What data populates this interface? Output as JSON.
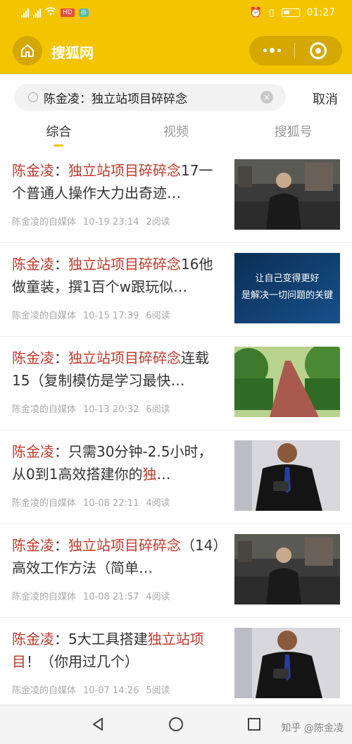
{
  "status_bar": {
    "carrier_badge": "HD",
    "time": "01:27"
  },
  "header": {
    "title": "搜狐网"
  },
  "search": {
    "query": "陈金凌：独立站项目碎碎念",
    "cancel_label": "取消"
  },
  "tabs": [
    {
      "label": "综合",
      "active": true
    },
    {
      "label": "视频",
      "active": false
    },
    {
      "label": "搜狐号",
      "active": false
    }
  ],
  "results": [
    {
      "title_parts": [
        {
          "text": "陈金凌",
          "hl": true
        },
        {
          "text": "：",
          "hl": false
        },
        {
          "text": "独立站项目碎碎念",
          "hl": true
        },
        {
          "text": "17一个普通人操作大力出奇迹…",
          "hl": false
        }
      ],
      "source": "陈金凌的自媒体",
      "date": "10-19 23:14",
      "reads": "2阅读",
      "thumb": "man-street"
    },
    {
      "title_parts": [
        {
          "text": "陈金凌",
          "hl": true
        },
        {
          "text": "：",
          "hl": false
        },
        {
          "text": "独立站项目碎碎念",
          "hl": true
        },
        {
          "text": "16他做童装，撰1百个w跟玩似…",
          "hl": false
        }
      ],
      "source": "陈金凌的自媒体",
      "date": "10-15 17:39",
      "reads": "6阅读",
      "thumb": "text-banner",
      "thumb_line1": "让自己变得更好",
      "thumb_line2": "是解决一切问题的关键"
    },
    {
      "title_parts": [
        {
          "text": "陈金凌",
          "hl": true
        },
        {
          "text": "：",
          "hl": false
        },
        {
          "text": "独立站项目碎碎念",
          "hl": true
        },
        {
          "text": "连载15（复制模仿是学习最快…",
          "hl": false
        }
      ],
      "source": "陈金凌的自媒体",
      "date": "10-13 20:32",
      "reads": "6阅读",
      "thumb": "garden-path"
    },
    {
      "title_parts": [
        {
          "text": "陈金凌",
          "hl": true
        },
        {
          "text": "：只需30分钟-2.5小时，从0到1高效搭建你的",
          "hl": false
        },
        {
          "text": "独",
          "hl": true
        },
        {
          "text": "…",
          "hl": false
        }
      ],
      "source": "陈金凌的自媒体",
      "date": "10-08 22:11",
      "reads": "4阅读",
      "thumb": "man-phone"
    },
    {
      "title_parts": [
        {
          "text": "陈金凌",
          "hl": true
        },
        {
          "text": "：",
          "hl": false
        },
        {
          "text": "独立站项目碎碎念",
          "hl": true
        },
        {
          "text": "（14）高效工作方法（简单…",
          "hl": false
        }
      ],
      "source": "陈金凌的自媒体",
      "date": "10-08 21:57",
      "reads": "4阅读",
      "thumb": "man-street"
    },
    {
      "title_parts": [
        {
          "text": "陈金凌",
          "hl": true
        },
        {
          "text": "：5大工具搭建",
          "hl": false
        },
        {
          "text": "独立站项目",
          "hl": true
        },
        {
          "text": "！（你用过几个）",
          "hl": false
        }
      ],
      "source": "陈金凌的自媒体",
      "date": "10-07 14:26",
      "reads": "5阅读",
      "thumb": "man-phone"
    }
  ],
  "watermark": "知乎 @陈金凌",
  "colors": {
    "brand_yellow": "#f5c400",
    "highlight_red": "#c0392b"
  }
}
